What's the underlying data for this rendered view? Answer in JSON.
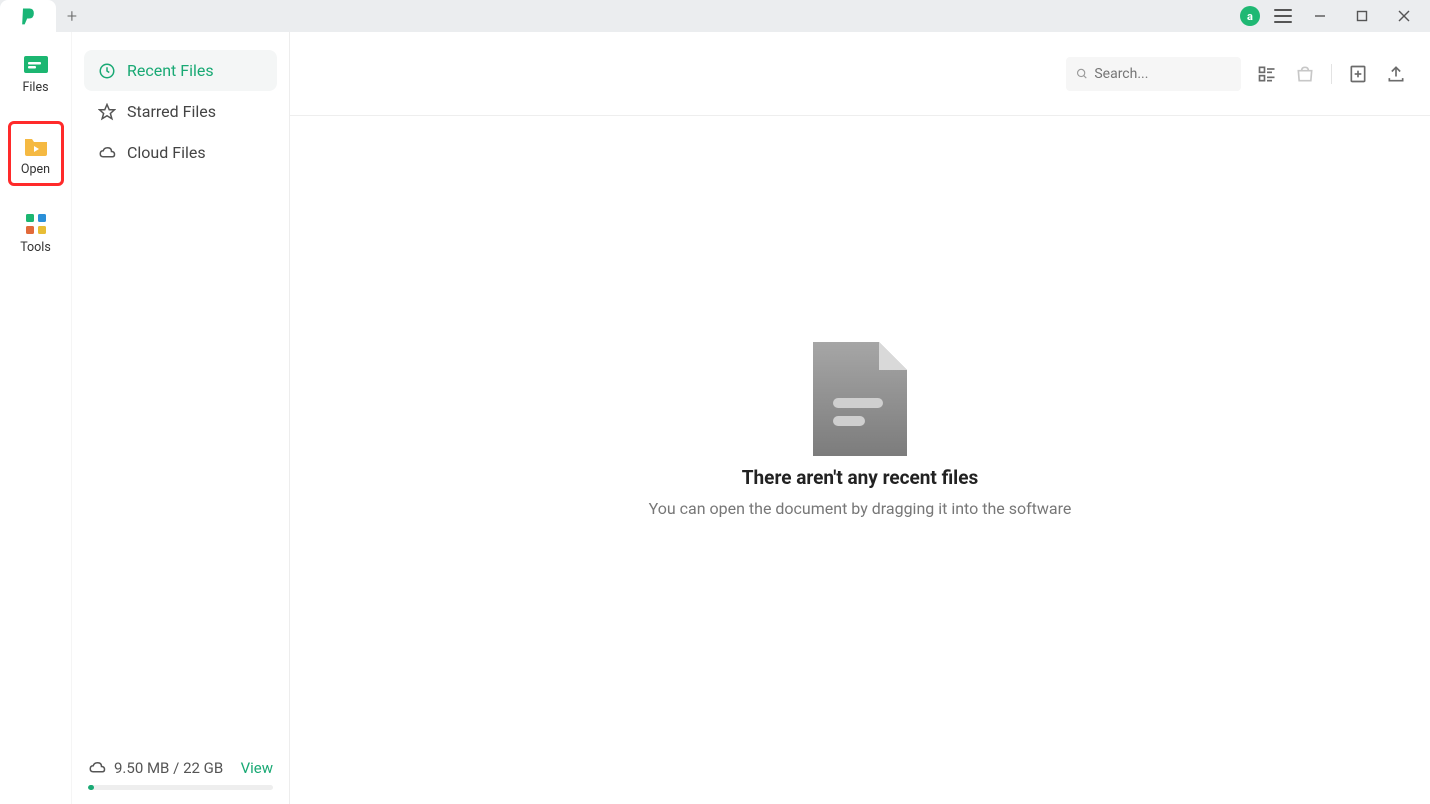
{
  "titlebar": {
    "avatar_label": "a"
  },
  "rail": {
    "items": [
      {
        "label": "Files"
      },
      {
        "label": "Open"
      },
      {
        "label": "Tools"
      }
    ]
  },
  "sidebar": {
    "items": [
      {
        "label": "Recent Files"
      },
      {
        "label": "Starred Files"
      },
      {
        "label": "Cloud Files"
      }
    ],
    "storage": {
      "used": "9.50 MB",
      "separator": " / ",
      "total": "22 GB",
      "view_label": "View"
    }
  },
  "toolbar": {
    "search_placeholder": "Search..."
  },
  "empty_state": {
    "title": "There aren't any recent files",
    "subtitle": "You can open the document by dragging it into the software"
  }
}
